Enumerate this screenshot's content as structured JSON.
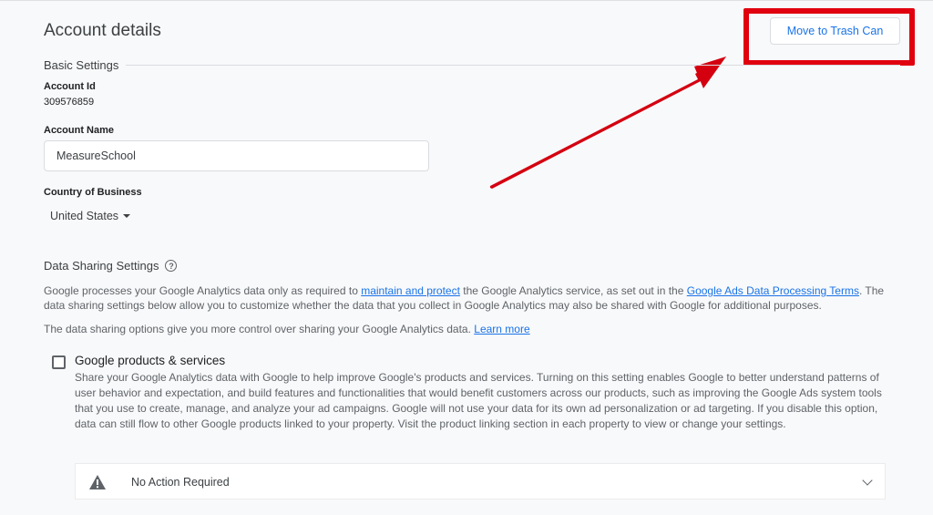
{
  "header": {
    "title": "Account details",
    "trash_button_label": "Move to Trash Can"
  },
  "annotation": {
    "highlight_color": "#e0000f",
    "arrow_color": "#d40010"
  },
  "basic_settings": {
    "section_title": "Basic Settings",
    "account_id_label": "Account Id",
    "account_id_value": "309576859",
    "account_name_label": "Account Name",
    "account_name_value": "MeasureSchool",
    "country_label": "Country of Business",
    "country_value": "United States"
  },
  "data_sharing": {
    "section_title": "Data Sharing Settings",
    "help_icon": "help-circle-icon",
    "intro_part1": "Google processes your Google Analytics data only as required to ",
    "intro_link1": "maintain and protect",
    "intro_part2": " the Google Analytics service, as set out in the ",
    "intro_link2": "Google Ads Data Processing Terms",
    "intro_part3": ". The data sharing settings below allow you to customize whether the data that you collect in Google Analytics may also be shared with Google for additional purposes.",
    "options_text": "The data sharing options give you more control over sharing your Google Analytics data. ",
    "learn_more": "Learn more",
    "link_color": "#1a73e8"
  },
  "google_products": {
    "checked": false,
    "title": "Google products & services",
    "description": "Share your Google Analytics data with Google to help improve Google's products and services. Turning on this setting enables Google to better understand patterns of user behavior and expectation, and build features and functionalities that would benefit customers across our products, such as improving the Google Ads system tools that you use to create, manage, and analyze your ad campaigns. Google will not use your data for its own ad personalization or ad targeting. If you disable this option, data can still flow to other Google products linked to your property. Visit the product linking section in each property to view or change your settings.",
    "status_icon": "warning-icon",
    "status_text": "No Action Required",
    "expand_icon": "chevron-down-icon"
  }
}
